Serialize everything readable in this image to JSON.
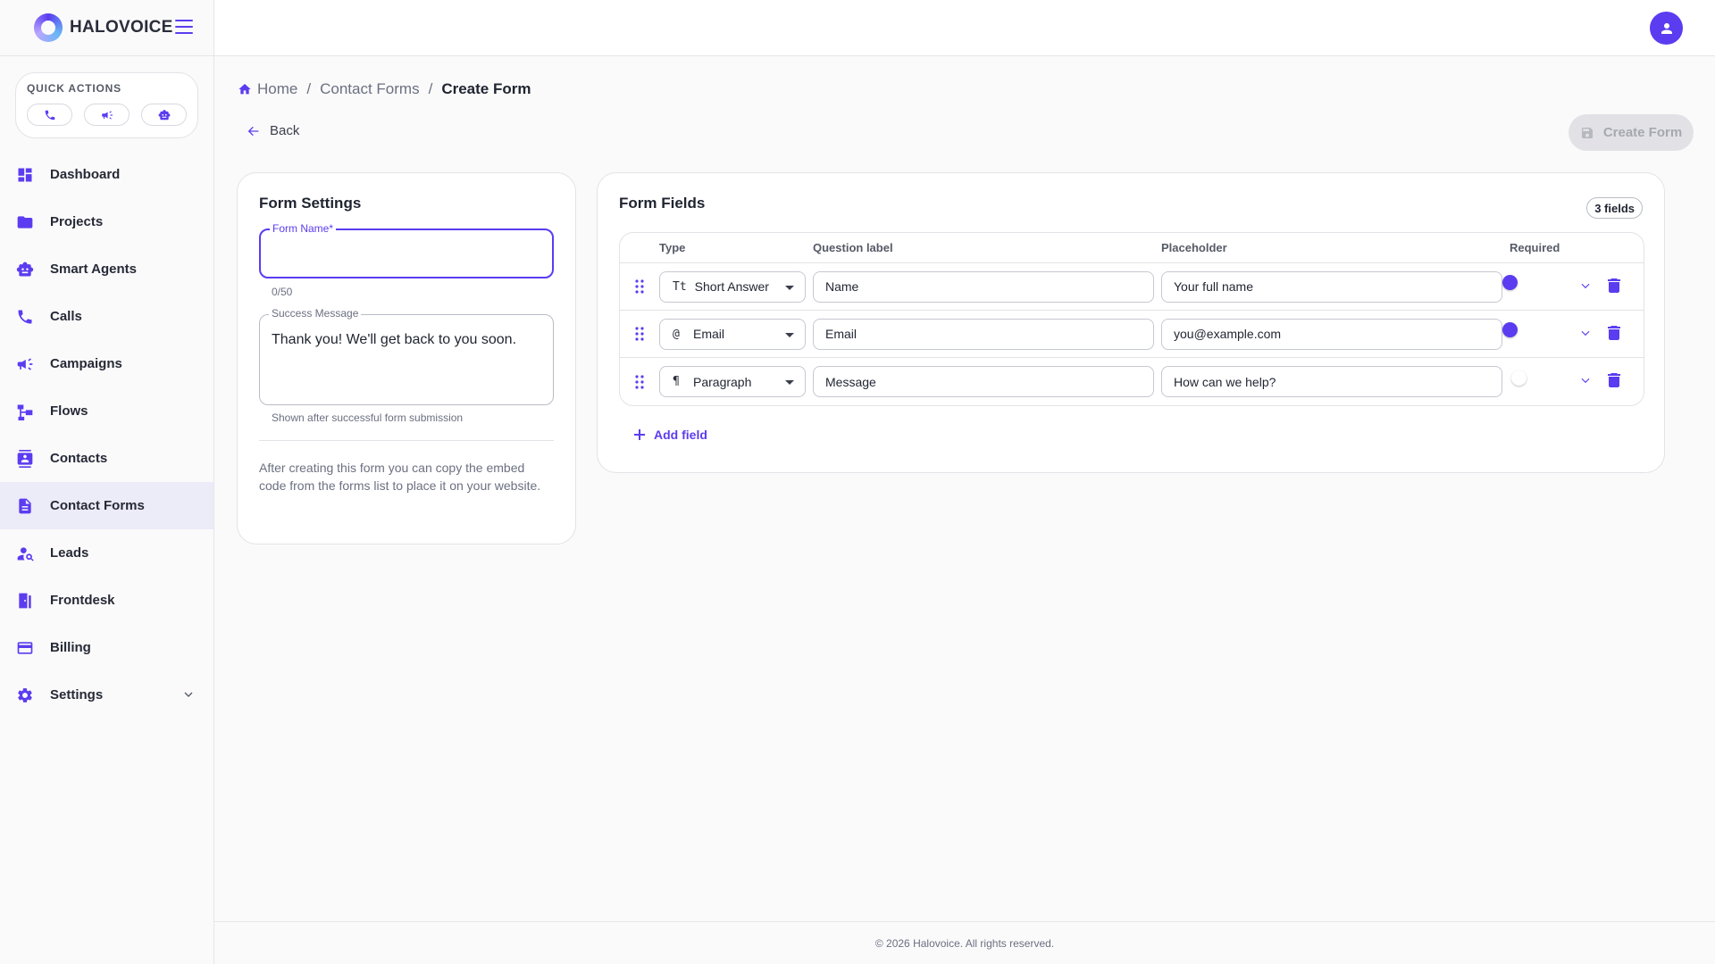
{
  "brand": {
    "name": "HALOVOICE"
  },
  "quick_actions": {
    "label": "QUICK ACTIONS",
    "buttons": [
      {
        "icon": "phone-icon"
      },
      {
        "icon": "megaphone-icon"
      },
      {
        "icon": "robot-icon"
      }
    ]
  },
  "sidebar": {
    "items": [
      {
        "label": "Dashboard",
        "icon": "dashboard-icon"
      },
      {
        "label": "Projects",
        "icon": "folder-icon"
      },
      {
        "label": "Smart Agents",
        "icon": "robot-icon"
      },
      {
        "label": "Calls",
        "icon": "phone-icon"
      },
      {
        "label": "Campaigns",
        "icon": "megaphone-icon"
      },
      {
        "label": "Flows",
        "icon": "flow-icon"
      },
      {
        "label": "Contacts",
        "icon": "contacts-icon"
      },
      {
        "label": "Contact Forms",
        "icon": "document-icon",
        "active": true
      },
      {
        "label": "Leads",
        "icon": "person-search-icon"
      },
      {
        "label": "Frontdesk",
        "icon": "door-icon"
      },
      {
        "label": "Billing",
        "icon": "credit-card-icon"
      },
      {
        "label": "Settings",
        "icon": "gear-icon"
      }
    ]
  },
  "breadcrumb": {
    "home": "Home",
    "section": "Contact Forms",
    "current": "Create Form",
    "separator": "/"
  },
  "toolbar": {
    "back_label": "Back",
    "create_label": "Create Form"
  },
  "settings": {
    "title": "Form Settings",
    "form_name_label": "Form Name",
    "form_name_required": "*",
    "form_name_value": "",
    "form_name_counter": "0/50",
    "success_label": "Success Message",
    "success_value": "Thank you! We'll get back to you soon.",
    "success_hint": "Shown after successful form submission",
    "info": "After creating this form you can copy the embed code from the forms list to place it on your website."
  },
  "fields": {
    "title": "Form Fields",
    "count_badge": "3 fields",
    "headers": {
      "type": "Type",
      "label": "Question label",
      "placeholder": "Placeholder",
      "required": "Required"
    },
    "rows": [
      {
        "type_icon": "Tt",
        "type": "Short Answer",
        "label": "Name",
        "placeholder": "Your full name",
        "required": true
      },
      {
        "type_icon": "@",
        "type": "Email",
        "label": "Email",
        "placeholder": "you@example.com",
        "required": true
      },
      {
        "type_icon": "¶",
        "type": "Paragraph",
        "label": "Message",
        "placeholder": "How can we help?",
        "required": false
      }
    ],
    "add_label": "Add field"
  },
  "footer": {
    "text": "© 2026 Halovoice. All rights reserved."
  },
  "colors": {
    "accent": "#5b3cf0",
    "active_bg": "#ecebf8"
  }
}
